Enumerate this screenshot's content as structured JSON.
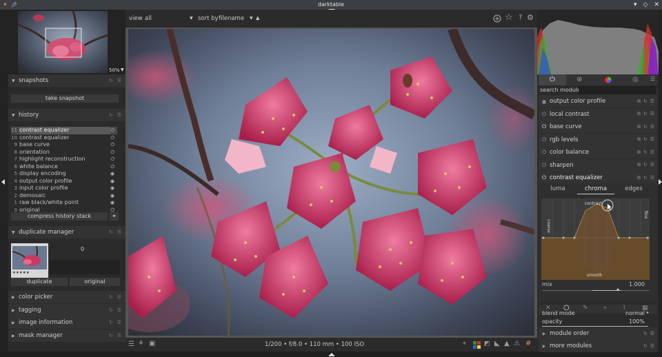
{
  "window": {
    "title": "darktable"
  },
  "left_panel": {
    "thumbnail_zoom": "50%",
    "snapshots": {
      "title": "snapshots",
      "take_label": "take snapshot"
    },
    "history": {
      "title": "history",
      "items": [
        {
          "n": "11",
          "label": "contrast equalizer",
          "selected": true
        },
        {
          "n": "10",
          "label": "contrast equalizer"
        },
        {
          "n": "9",
          "label": "base curve"
        },
        {
          "n": "8",
          "label": "orientation"
        },
        {
          "n": "7",
          "label": "highlight reconstruction"
        },
        {
          "n": "6",
          "label": "white balance"
        },
        {
          "n": "5",
          "label": "display encoding"
        },
        {
          "n": "4",
          "label": "output color profile"
        },
        {
          "n": "3",
          "label": "input color profile"
        },
        {
          "n": "2",
          "label": "demosaic"
        },
        {
          "n": "1",
          "label": "raw black/white point"
        },
        {
          "n": "0",
          "label": "original"
        }
      ],
      "compress_label": "compress history stack"
    },
    "duplicate_manager": {
      "title": "duplicate manager",
      "count": "0",
      "duplicate_label": "duplicate",
      "original_label": "original",
      "stars": "★★★★★"
    },
    "collapsed": [
      "color picker",
      "tagging",
      "image information",
      "mask manager"
    ]
  },
  "top_bar": {
    "view_label": "view",
    "view_value": "all",
    "sort_label": "sort by",
    "sort_value": "filename"
  },
  "bottom_bar": {
    "exif": "1/200 • f/8.0 • 110 mm • 100 ISO"
  },
  "right_panel": {
    "search_label": "search module",
    "modules": [
      "output color profile",
      "local contrast",
      "base curve",
      "rgb levels",
      "color balance",
      "sharpen",
      "contrast equalizer"
    ],
    "eq_tabs": [
      "luma",
      "chroma",
      "edges"
    ],
    "graph_labels": {
      "top": "contrast",
      "left": "coarse",
      "right": "fine",
      "bottom": "smooth"
    },
    "mix_label": "mix",
    "mix_value": "1.000",
    "blend_mode_label": "blend mode",
    "blend_mode_value": "normal",
    "opacity_label": "opacity",
    "opacity_value": "100%",
    "bottom_modules": [
      "module order",
      "more modules"
    ]
  }
}
